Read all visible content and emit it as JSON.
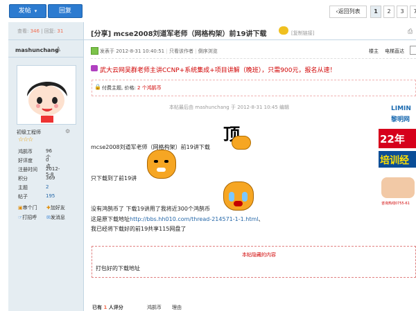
{
  "toolbar": {
    "post_label": "发帖",
    "reply_label": "回复",
    "back_label": "返回列表",
    "pages": [
      "1",
      "2",
      "3",
      "7"
    ]
  },
  "thread_stats": {
    "views_label": "查看:",
    "views": "346",
    "sep": "|",
    "replies_label": "回复:",
    "replies": "31"
  },
  "thread": {
    "title": "[分享] mcse2008刘道军老师（网格构架）前19讲下载",
    "copy_link": "[复制链接]"
  },
  "author": {
    "username": "mashunchang",
    "rank": "初级工程师",
    "fields": [
      {
        "label": "鸿鹄币",
        "value": "96 个"
      },
      {
        "label": "好评度",
        "value": "0 点"
      },
      {
        "label": "注册时间",
        "value": "2012-5-8"
      },
      {
        "label": "积分",
        "value": "369"
      },
      {
        "label": "主题",
        "value": "2"
      },
      {
        "label": "帖子",
        "value": "195"
      }
    ],
    "actions": [
      "串个门",
      "加好友",
      "打招呼",
      "发消息"
    ]
  },
  "post_meta": {
    "posted": "发表于 2012-8-31 10:40:51",
    "only_author": "只看该作者",
    "reverse": "倒序浏览",
    "floor": "楼主",
    "direct_label": "电梯直达"
  },
  "ad": {
    "text": "武大云网吴群老师主讲CCNP+系统集成+项目讲解（晚班），只需900元，报名从速！"
  },
  "paid": {
    "text": "付费主题, 价格: ",
    "price": "2 个鸿鹄币"
  },
  "edit_note": "本帖最后由 mashunchang 于 2012-8-31 10:45 编辑",
  "content": {
    "line1": "mcse2008刘道军老师（网格构架）前19讲下载",
    "line2": "只下载到了前19讲",
    "line3": "没有鸿鹄币了 下载19讲用了我将近300个鸿鹄币",
    "line4_prefix": "这是原下载地址",
    "line4_link": "http://bbs.hh010.com/thread-214571-1-1.html",
    "line4_suffix": "、",
    "line5": "我已经将下载好的前19共享115网盘了",
    "emoji_text": "顶"
  },
  "hidden": {
    "title": "本帖隐藏的内容",
    "body": "打包好的下载地址"
  },
  "rating": {
    "prefix": "已有",
    "count": "1",
    "suffix": "人评分",
    "col1": "鸿鹄币",
    "col2": "理由"
  },
  "side_ad": {
    "brand": "LIMIN",
    "brand_cn": "黎明网",
    "year": "22年",
    "course": "培训经",
    "phone": "咨询热线0755-61"
  },
  "colors": {
    "accent": "#2c7bd0",
    "ad_red": "#d00000",
    "link": "#2366a8",
    "sidebar": "#e5edf2"
  }
}
